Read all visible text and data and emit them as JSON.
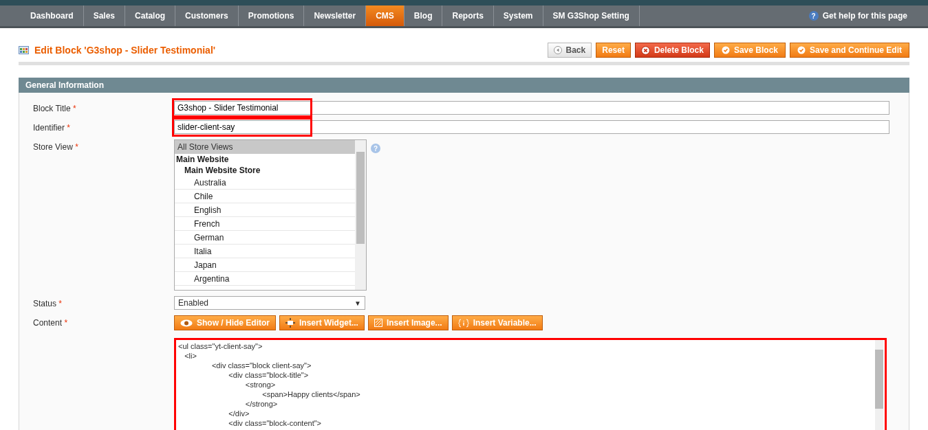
{
  "nav": {
    "items": [
      {
        "label": "Dashboard",
        "selected": false
      },
      {
        "label": "Sales",
        "selected": false
      },
      {
        "label": "Catalog",
        "selected": false
      },
      {
        "label": "Customers",
        "selected": false
      },
      {
        "label": "Promotions",
        "selected": false
      },
      {
        "label": "Newsletter",
        "selected": false
      },
      {
        "label": "CMS",
        "selected": true
      },
      {
        "label": "Blog",
        "selected": false
      },
      {
        "label": "Reports",
        "selected": false
      },
      {
        "label": "System",
        "selected": false
      },
      {
        "label": "SM G3Shop Setting",
        "selected": false
      }
    ],
    "help": "Get help for this page",
    "help_glyph": "?"
  },
  "page": {
    "title": "Edit Block 'G3shop - Slider Testimonial'",
    "buttons": [
      {
        "label": "Back",
        "kind": "back"
      },
      {
        "label": "Reset",
        "kind": "plain"
      },
      {
        "label": "Delete Block",
        "kind": "delete"
      },
      {
        "label": "Save Block",
        "kind": "save"
      },
      {
        "label": "Save and Continue Edit",
        "kind": "save"
      }
    ]
  },
  "section": {
    "title": "General Information",
    "block_title": {
      "label": "Block Title",
      "marker": "*",
      "value": "G3shop - Slider Testimonial",
      "highlighted": true
    },
    "identifier": {
      "label": "Identifier",
      "marker": "*",
      "value": "slider-client-say",
      "highlighted": true
    },
    "store_view": {
      "label": "Store View",
      "marker": "*",
      "help_glyph": "?",
      "options": [
        {
          "label": "All Store Views",
          "selected": true
        },
        {
          "label": "Main Website",
          "children": [
            {
              "label": "Main Website Store",
              "children": [
                {
                  "label": "Australia",
                  "selected": false
                },
                {
                  "label": "Chile",
                  "selected": false
                },
                {
                  "label": "English",
                  "selected": false
                },
                {
                  "label": "French",
                  "selected": false
                },
                {
                  "label": "German",
                  "selected": false
                },
                {
                  "label": "Italia",
                  "selected": false
                },
                {
                  "label": "Japan",
                  "selected": false
                },
                {
                  "label": "Argentina",
                  "selected": false
                }
              ]
            }
          ]
        }
      ]
    },
    "status": {
      "label": "Status",
      "marker": "*",
      "value": "Enabled",
      "arrow": "▼"
    },
    "content": {
      "label": "Content",
      "marker": "*",
      "highlighted": true,
      "buttons": [
        {
          "label": "Show / Hide Editor",
          "kind": "eye"
        },
        {
          "label": "Insert Widget...",
          "kind": "widget"
        },
        {
          "label": "Insert Image...",
          "kind": "image"
        },
        {
          "label": "Insert Variable...",
          "kind": "variable"
        }
      ],
      "code_lines": [
        "<ul class=\"yt-client-say\">",
        "   <li>",
        "\t\t<div class=\"block client-say\">",
        "\t\t\t<div class=\"block-title\">",
        "\t\t\t\t<strong>",
        "\t\t\t\t\t<span>Happy clients</span>",
        "\t\t\t\t</strong>",
        "\t\t\t</div>",
        "\t\t\t<div class=\"block-content\">"
      ]
    }
  }
}
